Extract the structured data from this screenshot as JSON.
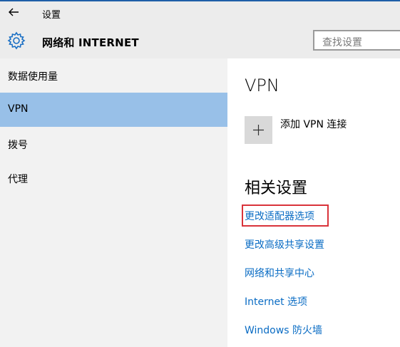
{
  "window": {
    "title": "设置"
  },
  "header": {
    "section_title": "网络和 INTERNET",
    "search_placeholder": "查找设置"
  },
  "sidebar": {
    "items": [
      {
        "label": "数据使用量",
        "selected": false
      },
      {
        "label": "VPN",
        "selected": true
      },
      {
        "label": "拨号",
        "selected": false
      },
      {
        "label": "代理",
        "selected": false
      }
    ]
  },
  "main": {
    "heading": "VPN",
    "add_vpn_label": "添加 VPN 连接",
    "related_heading": "相关设置",
    "links": [
      "更改适配器选项",
      "更改高级共享设置",
      "网络和共享中心",
      "Internet 选项",
      "Windows 防火墙"
    ]
  },
  "colors": {
    "accent": "#0a6cc4",
    "selected_bg": "#98c0e8",
    "highlight_border": "#d9333a"
  },
  "icons": {
    "back": "back-arrow-icon",
    "settings": "gear-icon",
    "add": "plus-icon"
  }
}
